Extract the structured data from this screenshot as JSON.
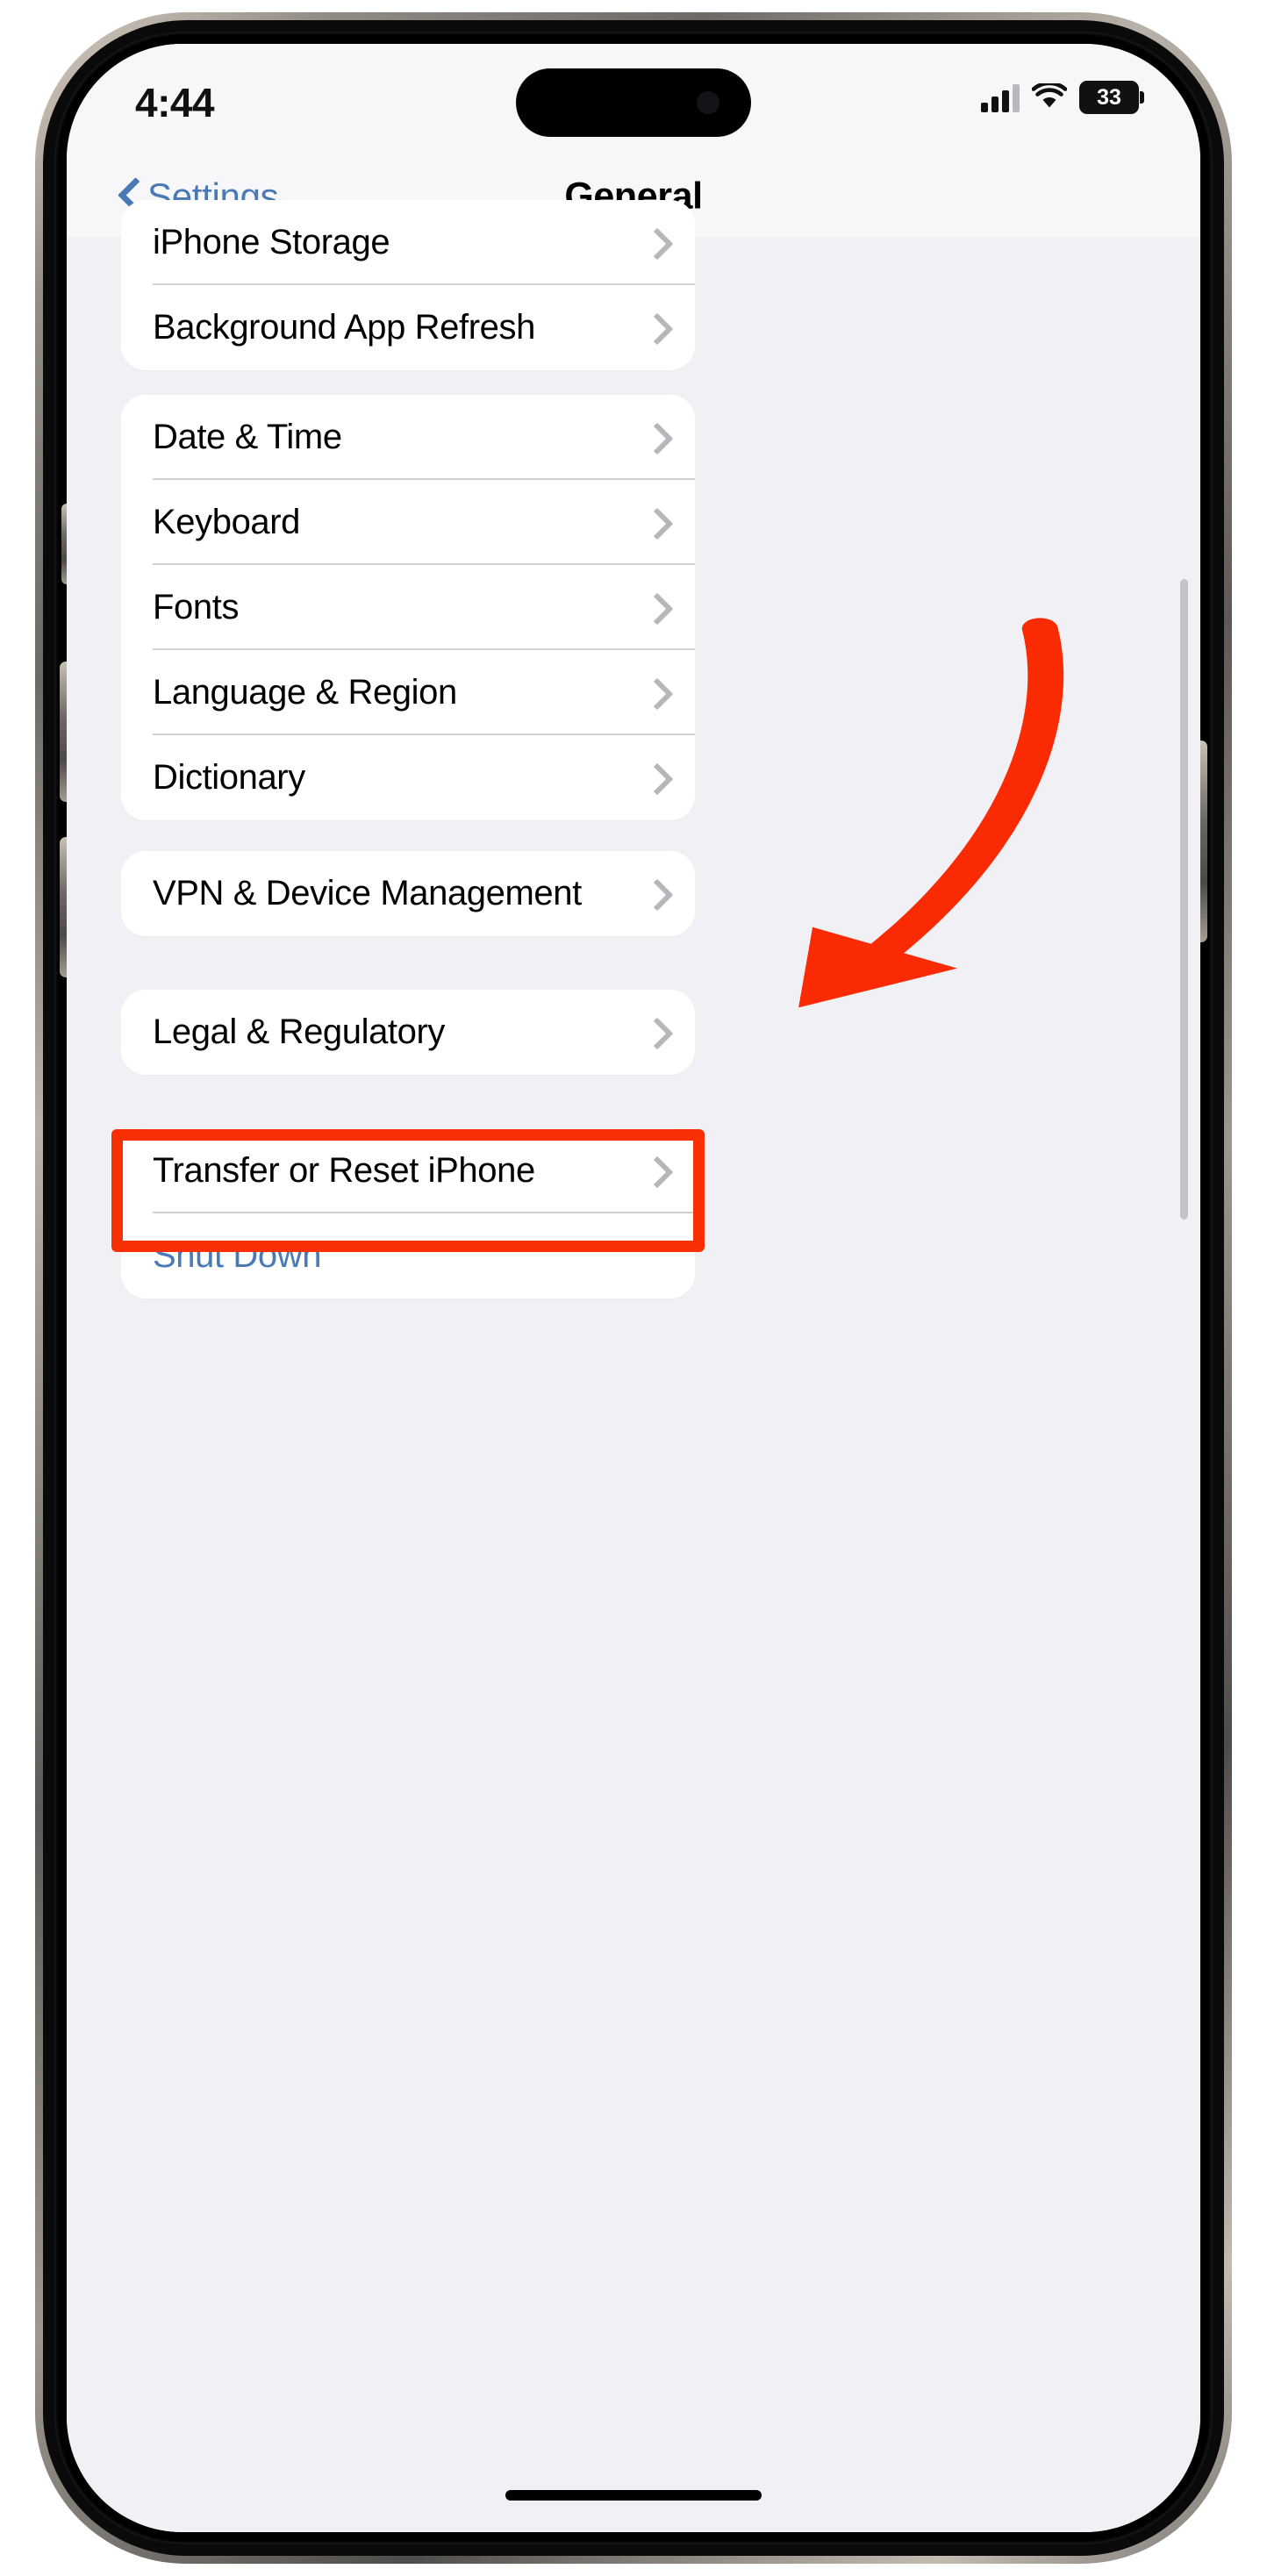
{
  "status_bar": {
    "time": "4:44",
    "battery_percent": "33",
    "icons": [
      "cellular-signal-icon",
      "wifi-icon",
      "battery-icon"
    ]
  },
  "nav_bar": {
    "back_label": "Settings",
    "title": "General",
    "back_icon": "chevron-left-icon"
  },
  "groups": [
    {
      "rows": [
        {
          "label": "iPhone Storage",
          "type": "disclosure",
          "clipped": true
        },
        {
          "label": "Background App Refresh",
          "type": "disclosure"
        }
      ]
    },
    {
      "rows": [
        {
          "label": "Date & Time",
          "type": "disclosure"
        },
        {
          "label": "Keyboard",
          "type": "disclosure"
        },
        {
          "label": "Fonts",
          "type": "disclosure"
        },
        {
          "label": "Language & Region",
          "type": "disclosure"
        },
        {
          "label": "Dictionary",
          "type": "disclosure"
        }
      ]
    },
    {
      "rows": [
        {
          "label": "VPN & Device Management",
          "type": "disclosure"
        }
      ]
    },
    {
      "rows": [
        {
          "label": "Legal & Regulatory",
          "type": "disclosure"
        }
      ]
    },
    {
      "rows": [
        {
          "label": "Transfer or Reset iPhone",
          "type": "disclosure",
          "highlighted": true
        },
        {
          "label": "Shut Down",
          "type": "action-link"
        }
      ]
    }
  ],
  "annotations": {
    "arrow_color": "#fa2a02",
    "highlight_color": "#fa3005",
    "arrow_name": "red-curved-arrow",
    "highlight_target": "Transfer or Reset iPhone"
  },
  "colors": {
    "accent_blue": "#4a7ab5",
    "page_background": "#f1f1f5",
    "card_background": "#ffffff",
    "separator": "#d3d1cf",
    "chevron_gray": "#b6b6bb"
  }
}
